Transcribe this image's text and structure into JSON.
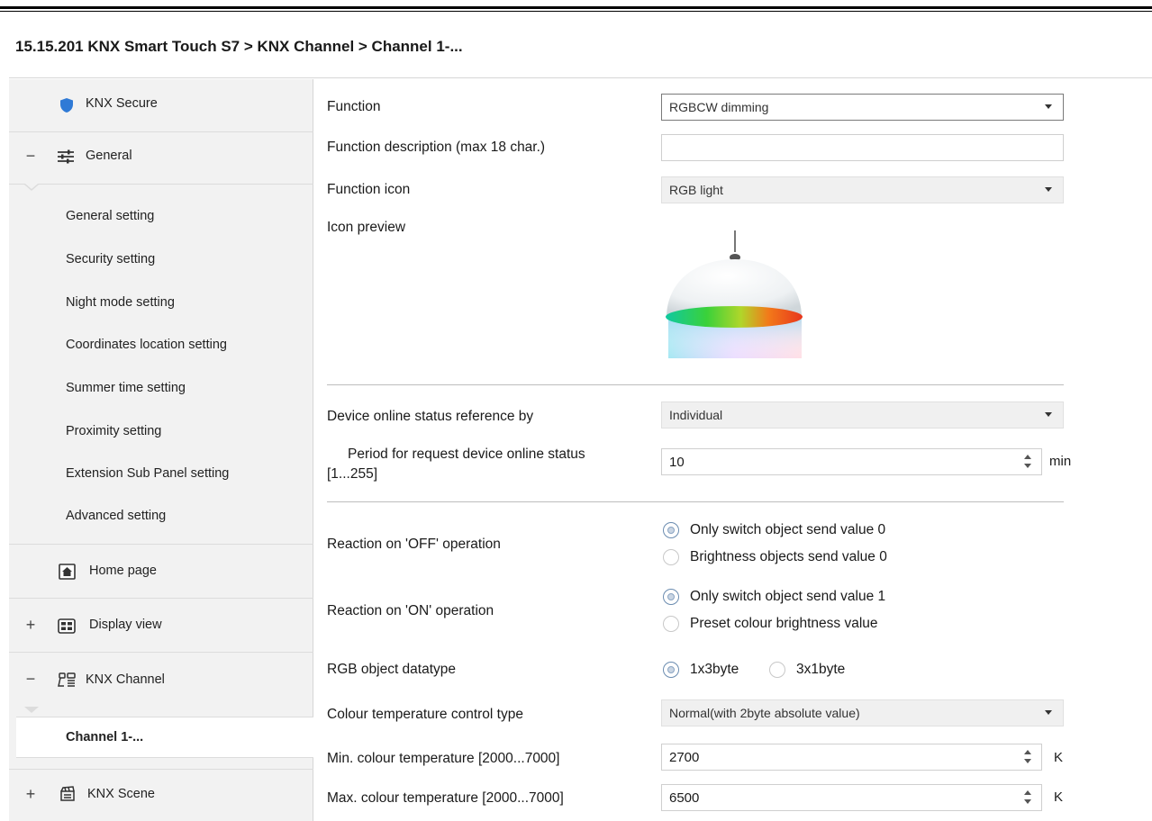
{
  "breadcrumb": "15.15.201 KNX Smart Touch S7 > KNX Channel  > Channel 1-...",
  "sidebar": {
    "knx_secure": "KNX Secure",
    "general": {
      "sign": "−",
      "label": "General"
    },
    "general_items": [
      "General setting",
      "Security setting",
      "Night mode setting",
      "Coordinates location setting",
      "Summer time setting",
      "Proximity setting",
      "Extension Sub Panel setting",
      "Advanced setting"
    ],
    "home_page": "Home page",
    "display_view": {
      "sign": "+",
      "label": "Display view"
    },
    "knx_channel": {
      "sign": "−",
      "label": "KNX Channel"
    },
    "channel_active": "Channel 1-...",
    "knx_scene": {
      "sign": "+",
      "label": "KNX Scene"
    }
  },
  "main": {
    "function": {
      "label": "Function",
      "value": "RGBCW dimming"
    },
    "function_description": {
      "label": "Function description (max 18 char.)",
      "value": ""
    },
    "function_icon": {
      "label": "Function icon",
      "value": "RGB light"
    },
    "icon_preview": {
      "label": "Icon preview"
    },
    "online_status_ref": {
      "label": "Device online status reference by",
      "value": "Individual"
    },
    "request_period": {
      "label_line1": "Period for request device online status",
      "label_line2": "[1...255]",
      "value": "10",
      "unit": "min"
    },
    "reaction_off": {
      "label": "Reaction on 'OFF' operation",
      "options": [
        "Only switch object send value 0",
        "Brightness objects send value 0"
      ],
      "selected": 0
    },
    "reaction_on": {
      "label": "Reaction on 'ON' operation",
      "options": [
        "Only switch object send value 1",
        "Preset colour brightness value"
      ],
      "selected": 0
    },
    "rgb_datatype": {
      "label": "RGB object datatype",
      "options": [
        "1x3byte",
        "3x1byte"
      ],
      "selected": 0
    },
    "ct_control_type": {
      "label": "Colour temperature control type",
      "value": "Normal(with 2byte absolute value)"
    },
    "min_ct": {
      "label": "Min. colour temperature [2000...7000]",
      "value": "2700",
      "unit": "K"
    },
    "max_ct": {
      "label": "Max. colour temperature [2000...7000]",
      "value": "6500",
      "unit": "K"
    }
  },
  "colors": {
    "sidebar_bg": "#f2f2f2",
    "shield_blue": "#2f7ad6",
    "radio_accent": "#6b8cb0"
  },
  "icons": [
    "shield-icon",
    "sliders-icon",
    "home-icon",
    "display-grid-icon",
    "channel-icon",
    "scene-icon",
    "dropdown-caret-icon",
    "spin-arrows-icon",
    "rgb-lamp-icon"
  ]
}
